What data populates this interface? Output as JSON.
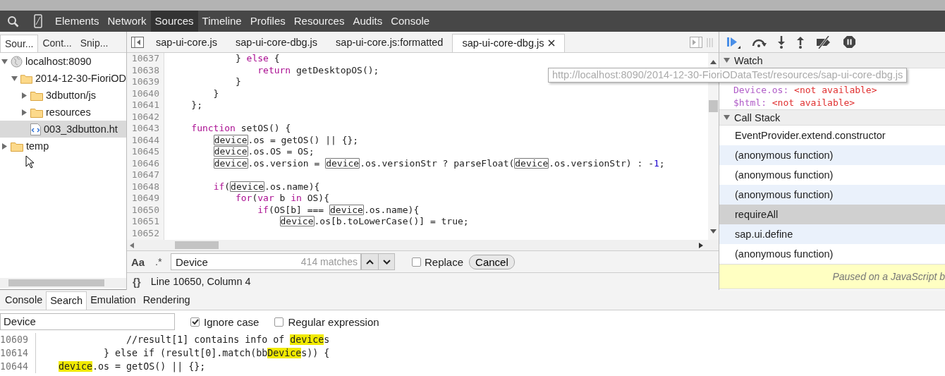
{
  "top_tabs": [
    {
      "label": "Elements",
      "selected": false
    },
    {
      "label": "Network",
      "selected": false
    },
    {
      "label": "Sources",
      "selected": true
    },
    {
      "label": "Timeline",
      "selected": false
    },
    {
      "label": "Profiles",
      "selected": false
    },
    {
      "label": "Resources",
      "selected": false
    },
    {
      "label": "Audits",
      "selected": false
    },
    {
      "label": "Console",
      "selected": false
    }
  ],
  "navigator": {
    "tabs": [
      {
        "label": "Sour...",
        "selected": true
      },
      {
        "label": "Cont...",
        "selected": false
      },
      {
        "label": "Snip...",
        "selected": false
      }
    ],
    "tree": [
      {
        "label": "localhost:8090",
        "kind": "domain",
        "expanded": true,
        "selected": false,
        "children": [
          {
            "label": "2014-12-30-FioriOD",
            "kind": "folder",
            "expanded": true,
            "selected": false,
            "children": [
              {
                "label": "3dbutton/js",
                "kind": "folder",
                "expanded": false,
                "selected": false
              },
              {
                "label": "resources",
                "kind": "folder",
                "expanded": false,
                "selected": false
              },
              {
                "label": "003_3dbutton.ht",
                "kind": "file",
                "selected": true
              }
            ]
          }
        ]
      },
      {
        "label": "temp",
        "kind": "folder",
        "expanded": false,
        "selected": false
      }
    ]
  },
  "editor": {
    "tabs": [
      {
        "label": "sap-ui-core.js",
        "selected": false,
        "closable": false
      },
      {
        "label": "sap-ui-core-dbg.js",
        "selected": false,
        "closable": false
      },
      {
        "label": "sap-ui-core.js:formatted",
        "selected": false,
        "closable": false
      },
      {
        "label": "sap-ui-core-dbg.js",
        "selected": true,
        "closable": true
      }
    ],
    "lines": [
      {
        "number": "10637",
        "code": [
          {
            "text": "            } ",
            "kind": "plain"
          },
          {
            "text": "else",
            "kind": "keyword"
          },
          {
            "text": " {",
            "kind": "plain"
          }
        ]
      },
      {
        "number": "10638",
        "code": [
          {
            "text": "                return",
            "kind": "keyword"
          },
          {
            "text": " getDesktopOS();",
            "kind": "plain"
          }
        ]
      },
      {
        "number": "10639",
        "code": [
          {
            "text": "            }",
            "kind": "plain"
          }
        ]
      },
      {
        "number": "10640",
        "code": [
          {
            "text": "        }",
            "kind": "plain"
          }
        ]
      },
      {
        "number": "10641",
        "code": [
          {
            "text": "    };",
            "kind": "plain"
          }
        ]
      },
      {
        "number": "10642"
      },
      {
        "number": "10643",
        "code": [
          {
            "text": "    function",
            "kind": "keyword"
          },
          {
            "text": " setOS() {",
            "kind": "plain"
          }
        ]
      },
      {
        "number": "10644",
        "code": [
          {
            "text": "        device",
            "kind": "match"
          },
          {
            "text": ".os = getOS() || {};",
            "kind": "plain"
          }
        ]
      },
      {
        "number": "10645",
        "code": [
          {
            "text": "        device",
            "kind": "match"
          },
          {
            "text": ".os.OS = OS;",
            "kind": "plain"
          }
        ]
      },
      {
        "number": "10646",
        "code": [
          {
            "text": "        device",
            "kind": "match"
          },
          {
            "text": ".os.version = ",
            "kind": "plain"
          },
          {
            "text": "device",
            "kind": "match"
          },
          {
            "text": ".os.versionStr ? parseFloat(",
            "kind": "plain"
          },
          {
            "text": "device",
            "kind": "match"
          },
          {
            "text": ".os.versionStr) : -",
            "kind": "plain"
          },
          {
            "text": "1",
            "kind": "number"
          },
          {
            "text": ";",
            "kind": "plain"
          }
        ]
      },
      {
        "number": "10647"
      },
      {
        "number": "10648",
        "code": [
          {
            "text": "        if",
            "kind": "keyword"
          },
          {
            "text": "(",
            "kind": "plain"
          },
          {
            "text": "device",
            "kind": "match"
          },
          {
            "text": ".os.name){",
            "kind": "plain"
          }
        ]
      },
      {
        "number": "10649",
        "code": [
          {
            "text": "            for",
            "kind": "keyword"
          },
          {
            "text": "(",
            "kind": "plain"
          },
          {
            "text": "var",
            "kind": "keyword"
          },
          {
            "text": " b ",
            "kind": "plain"
          },
          {
            "text": "in",
            "kind": "keyword"
          },
          {
            "text": " OS){",
            "kind": "plain"
          }
        ]
      },
      {
        "number": "10650",
        "code": [
          {
            "text": "                if",
            "kind": "keyword"
          },
          {
            "text": "(OS[b] === ",
            "kind": "plain"
          },
          {
            "text": "device",
            "kind": "match"
          },
          {
            "text": ".os.name){",
            "kind": "plain"
          }
        ]
      },
      {
        "number": "10651",
        "code": [
          {
            "text": "                    device",
            "kind": "match"
          },
          {
            "text": ".os[b.toLowerCase()] = true;",
            "kind": "plain"
          }
        ]
      },
      {
        "number": "10652"
      }
    ],
    "tooltip": "http://localhost:8090/2014-12-30-FioriODataTest/resources/sap-ui-core-dbg.js",
    "search": {
      "case_label": "Aa",
      "regex_label": ".*",
      "value": "Device",
      "matches": "414 matches",
      "replace_label": "Replace",
      "replace_checked": false,
      "cancel": "Cancel"
    },
    "format_label": "{}",
    "status": "Line 10650, Column 4"
  },
  "debugger": {
    "watch": {
      "title": "Watch",
      "expanded": true,
      "items": [
        {
          "expression": "Device.os:",
          "value": "<not available>"
        },
        {
          "expression": "$html:",
          "value": "<not available>"
        }
      ]
    },
    "call_stack": {
      "title": "Call Stack",
      "expanded": true,
      "frames": [
        {
          "label": "EventProvider.extend.constructor",
          "selected": false
        },
        {
          "label": "(anonymous function)",
          "selected": false
        },
        {
          "label": "(anonymous function)",
          "selected": false
        },
        {
          "label": "(anonymous function)",
          "selected": false
        },
        {
          "label": "requireAll",
          "selected": true
        },
        {
          "label": "sap.ui.define",
          "selected": false
        },
        {
          "label": "(anonymous function)",
          "selected": false
        }
      ]
    },
    "paused_message": "Paused on a JavaScript b"
  },
  "drawer": {
    "tabs": [
      {
        "label": "Console",
        "selected": false
      },
      {
        "label": "Search",
        "selected": true
      },
      {
        "label": "Emulation",
        "selected": false
      },
      {
        "label": "Rendering",
        "selected": false
      }
    ],
    "search": {
      "value": "Device",
      "options": [
        {
          "label": "Ignore case",
          "checked": true
        },
        {
          "label": "Regular expression",
          "checked": false
        }
      ]
    },
    "results": [
      {
        "number": "10609",
        "code": [
          {
            "text": "                //result[1] contains info of ",
            "kind": "plain"
          },
          {
            "text": "device",
            "kind": "hit"
          },
          {
            "text": "s",
            "kind": "plain"
          }
        ]
      },
      {
        "number": "10614",
        "code": [
          {
            "text": "            } else if (result[0].match(bb",
            "kind": "plain"
          },
          {
            "text": "Device",
            "kind": "hit"
          },
          {
            "text": "s)) {",
            "kind": "plain"
          }
        ]
      },
      {
        "number": "10644",
        "code": [
          {
            "text": "    device",
            "kind": "hit"
          },
          {
            "text": ".os = getOS() || {};",
            "kind": "plain"
          }
        ]
      }
    ]
  }
}
